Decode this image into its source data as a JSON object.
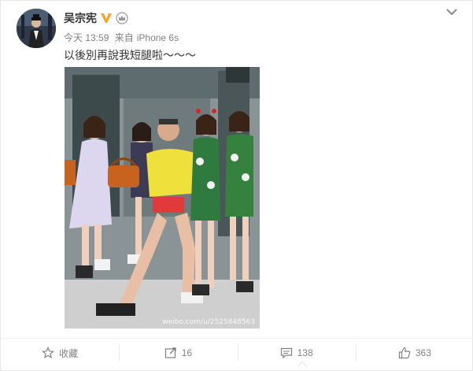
{
  "post": {
    "username": "吴宗宪",
    "time": "今天 13:59",
    "source_prefix": "来自",
    "source": "iPhone 6s",
    "text": "以後別再說我短腿啦～～～",
    "watermark": "weibo.com/u/2525848563"
  },
  "actions": {
    "favorite_label": "收藏",
    "repost_count": "16",
    "comment_count": "138",
    "like_count": "363"
  },
  "colors": {
    "accent_verified": "#f5a623",
    "text_main": "#333333",
    "text_muted": "#808080"
  }
}
